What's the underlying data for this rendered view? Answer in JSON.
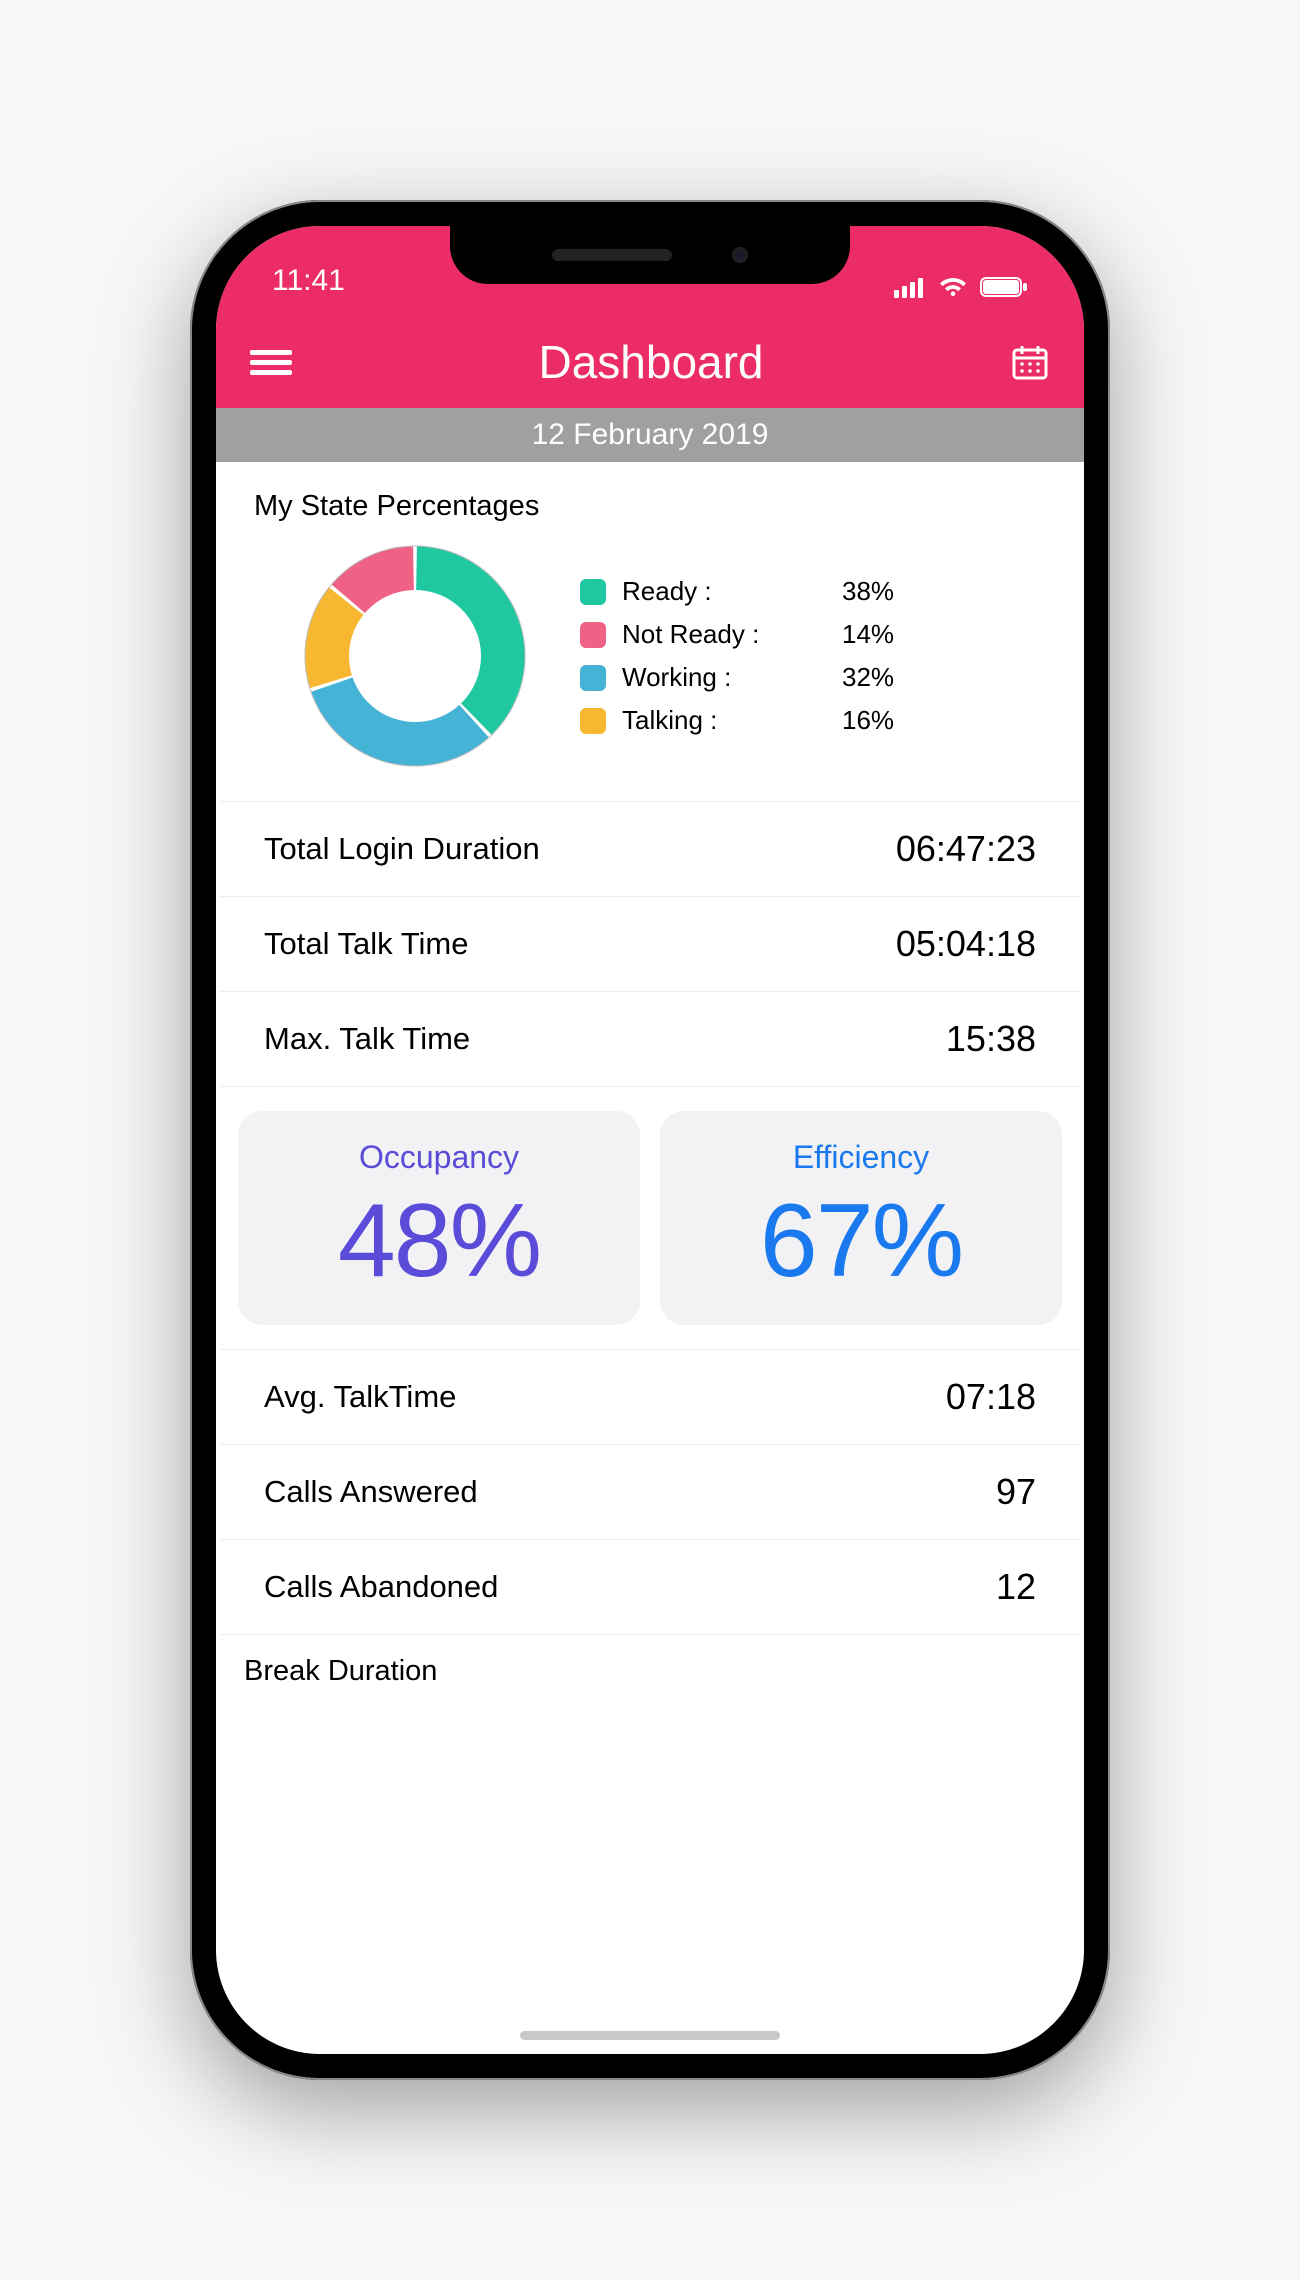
{
  "status": {
    "time": "11:41"
  },
  "header": {
    "title": "Dashboard"
  },
  "date_bar": "12 February 2019",
  "section_title": "My State Percentages",
  "chart_data": {
    "type": "pie",
    "title": "My State Percentages",
    "series": [
      {
        "name": "Ready",
        "value": 38,
        "color": "#1fc8a0"
      },
      {
        "name": "Not Ready",
        "value": 14,
        "color": "#f06285"
      },
      {
        "name": "Working",
        "value": 32,
        "color": "#45b3d6"
      },
      {
        "name": "Talking",
        "value": 16,
        "color": "#f7b731"
      }
    ]
  },
  "legend": [
    {
      "label": "Ready :",
      "value": "38%"
    },
    {
      "label": "Not Ready :",
      "value": "14%"
    },
    {
      "label": "Working :",
      "value": "32%"
    },
    {
      "label": "Talking :",
      "value": "16%"
    }
  ],
  "metrics_top": [
    {
      "label": "Total Login Duration",
      "value": "06:47:23"
    },
    {
      "label": "Total Talk Time",
      "value": "05:04:18"
    },
    {
      "label": "Max. Talk Time",
      "value": "15:38"
    }
  ],
  "cards": {
    "occupancy": {
      "title": "Occupancy",
      "value": "48%"
    },
    "efficiency": {
      "title": "Efficiency",
      "value": "67%"
    }
  },
  "metrics_bottom": [
    {
      "label": "Avg. TalkTime",
      "value": "07:18"
    },
    {
      "label": "Calls Answered",
      "value": "97"
    },
    {
      "label": "Calls Abandoned",
      "value": "12"
    }
  ],
  "cut_off_section": "Break Duration"
}
